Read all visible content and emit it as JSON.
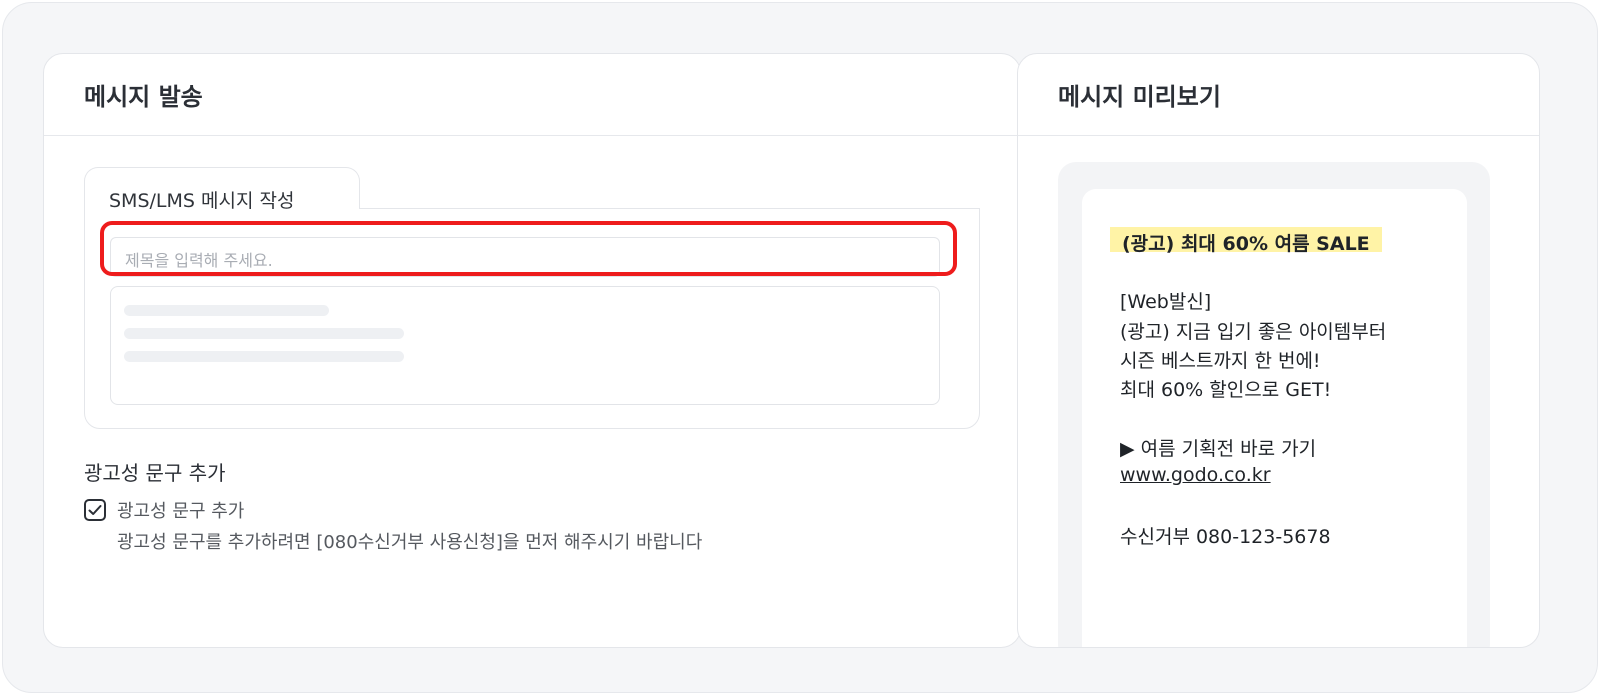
{
  "send_panel": {
    "title": "메시지 발송",
    "tab_label": "SMS/LMS 메시지 작성",
    "title_placeholder": "제목을 입력해 주세요.",
    "ad_section_title": "광고성 문구 추가",
    "ad_checkbox_label": "광고성 문구 추가",
    "ad_checkbox_checked": true,
    "ad_description": "광고성 문구를 추가하려면 [080수신거부 사용신청]을 먼저 해주시기 바랍니다"
  },
  "preview_panel": {
    "title": "메시지 미리보기",
    "headline": "(광고) 최대 60% 여름 SALE",
    "lines": [
      "[Web발신]",
      "(광고) 지금 입기 좋은 아이템부터",
      "시즌 베스트까지 한 번에!",
      "최대 60% 할인으로 GET!",
      "▶ 여름 기획전 바로 가기"
    ],
    "link": "www.godo.co.kr",
    "reject": "수신거부 080-123-5678"
  },
  "colors": {
    "highlight_border": "#ee1c1c",
    "headline_bg": "#fff3a6"
  },
  "icons": {
    "checkbox": "check-icon"
  }
}
